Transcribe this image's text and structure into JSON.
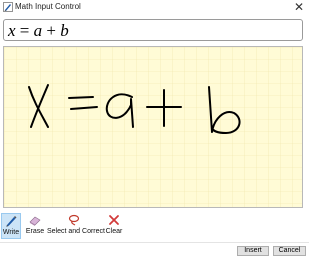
{
  "window": {
    "title": "Math Input Control",
    "app_icon": "math-input-pen-icon",
    "close_icon": "close-icon",
    "close_glyph": "✕"
  },
  "preview": {
    "parts": [
      "x",
      "=",
      "a",
      "+",
      "b"
    ]
  },
  "toolbar": {
    "tools": [
      {
        "label": "Write",
        "icon": "pen-icon",
        "active": true
      },
      {
        "label": "Erase",
        "icon": "eraser-icon",
        "active": false
      },
      {
        "label": "Select and Correct",
        "icon": "lasso-select-icon",
        "active": false
      },
      {
        "label": "Clear",
        "icon": "clear-icon",
        "active": false
      }
    ]
  },
  "buttons": {
    "insert_label": "Insert",
    "cancel_label": "Cancel"
  },
  "colors": {
    "writing_background": "#fffbd6",
    "grid_line": "#efe4a8",
    "ink": "#000000",
    "active_tool_bg": "#cce4f7",
    "pen_accent": "#1e5aa8",
    "erase_accent": "#c8a0c8",
    "clear_accent": "#d23a3a"
  }
}
